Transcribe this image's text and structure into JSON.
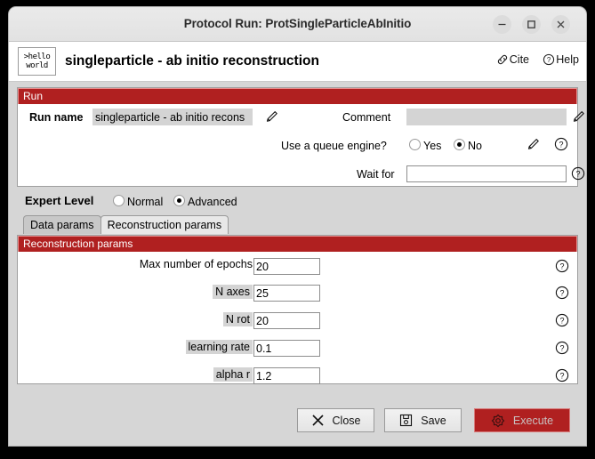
{
  "window": {
    "title": "Protocol Run: ProtSingleParticleAbInitio",
    "controls": {
      "minimize": "minimize-button",
      "maximize": "maximize-button",
      "close": "close-button"
    }
  },
  "header": {
    "logo_line1": ">hello",
    "logo_line2": "world",
    "title": "singleparticle - ab initio reconstruction",
    "cite_label": "Cite",
    "help_label": "Help"
  },
  "run_section": {
    "title": "Run",
    "run_name_label": "Run name",
    "run_name_value": "singleparticle - ab initio recons",
    "comment_label": "Comment",
    "comment_value": "",
    "queue_label": "Use a queue engine?",
    "queue_options": [
      "Yes",
      "No"
    ],
    "queue_selected": "No",
    "wait_for_label": "Wait for",
    "wait_for_value": ""
  },
  "expert": {
    "label": "Expert Level",
    "options": [
      "Normal",
      "Advanced"
    ],
    "selected": "Advanced"
  },
  "tabs": [
    {
      "label": "Data params",
      "active": false
    },
    {
      "label": "Reconstruction params",
      "active": true
    }
  ],
  "params_section": {
    "title": "Reconstruction params",
    "rows": [
      {
        "label": "Max number of epochs",
        "value": "20",
        "highlight": false
      },
      {
        "label": "N axes",
        "value": "25",
        "highlight": true
      },
      {
        "label": "N rot",
        "value": "20",
        "highlight": true
      },
      {
        "label": "learning rate",
        "value": "0.1",
        "highlight": true
      },
      {
        "label": "alpha r",
        "value": "1.2",
        "highlight": true
      }
    ]
  },
  "footer": {
    "close_label": "Close",
    "save_label": "Save",
    "execute_label": "Execute"
  },
  "colors": {
    "section_header_red": "#b02020",
    "section_header_border": "#e88d8d",
    "window_background": "#d6d6d6",
    "panel_background": "#ffffff",
    "disabled_field": "#d4d4d4"
  }
}
